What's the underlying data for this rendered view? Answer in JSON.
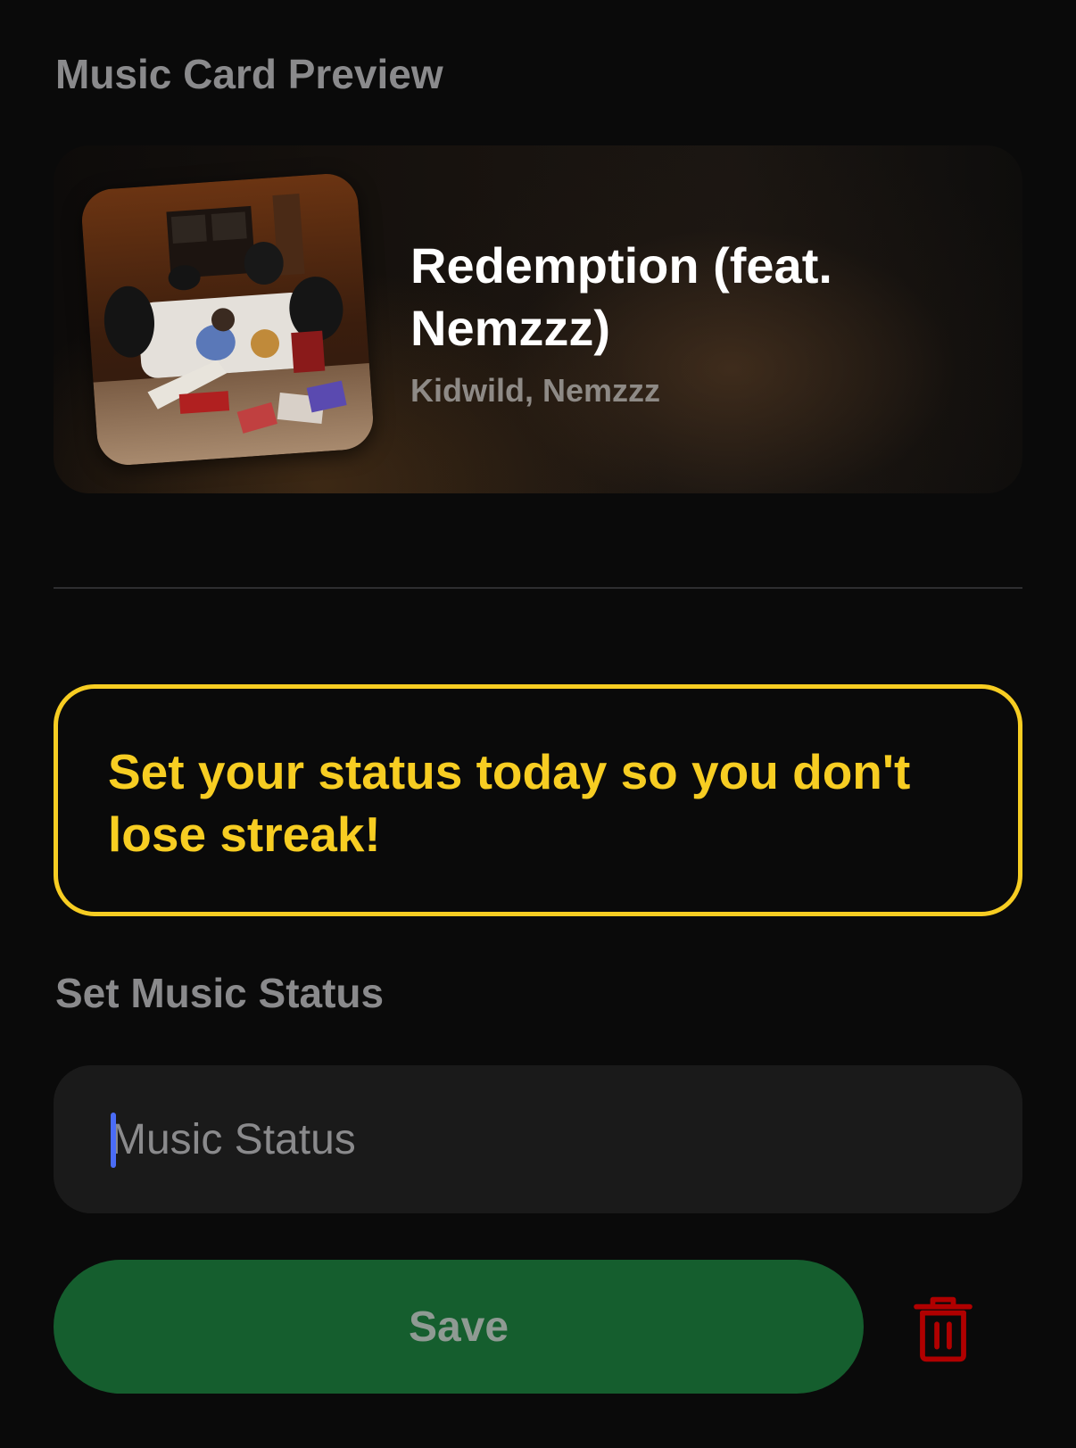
{
  "preview_section": {
    "title": "Music Card Preview"
  },
  "music_card": {
    "track_title": "Redemption (feat. Nemzzz)",
    "artists": "Kidwild, Nemzzz",
    "album_art_icon": "album-cover-image"
  },
  "streak_banner": {
    "message": "Set your status today so you don't lose streak!",
    "accent_color": "#f7cd22"
  },
  "status_section": {
    "title": "Set Music Status",
    "input_value": "",
    "input_placeholder": "Music Status"
  },
  "actions": {
    "save_label": "Save",
    "save_color": "#155e2e",
    "delete_icon": "trash-icon",
    "delete_color": "#b00000"
  }
}
